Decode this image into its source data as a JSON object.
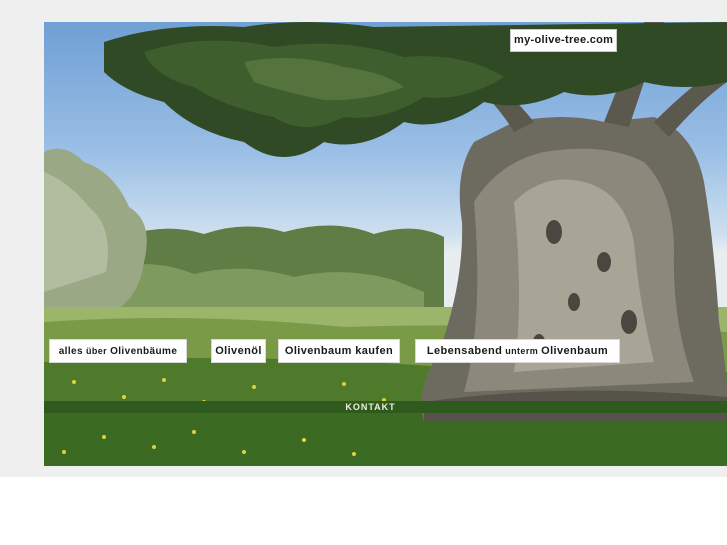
{
  "site": {
    "badge": "my-olive-tree.com"
  },
  "nav": {
    "item1": {
      "pre": "alles",
      "small": "über",
      "post": "Olivenbäume"
    },
    "item2": "Olivenöl",
    "item3": "Olivenbaum kaufen",
    "item4": {
      "pre": "Lebensabend",
      "small": "unterm",
      "post": "Olivenbaum"
    }
  },
  "footer": {
    "contact": "KONTAKT"
  },
  "hero": {
    "image": "olive-tree-landscape-photo"
  },
  "colors": {
    "bar": "#2f5a1d",
    "page_background": "#efefef"
  }
}
